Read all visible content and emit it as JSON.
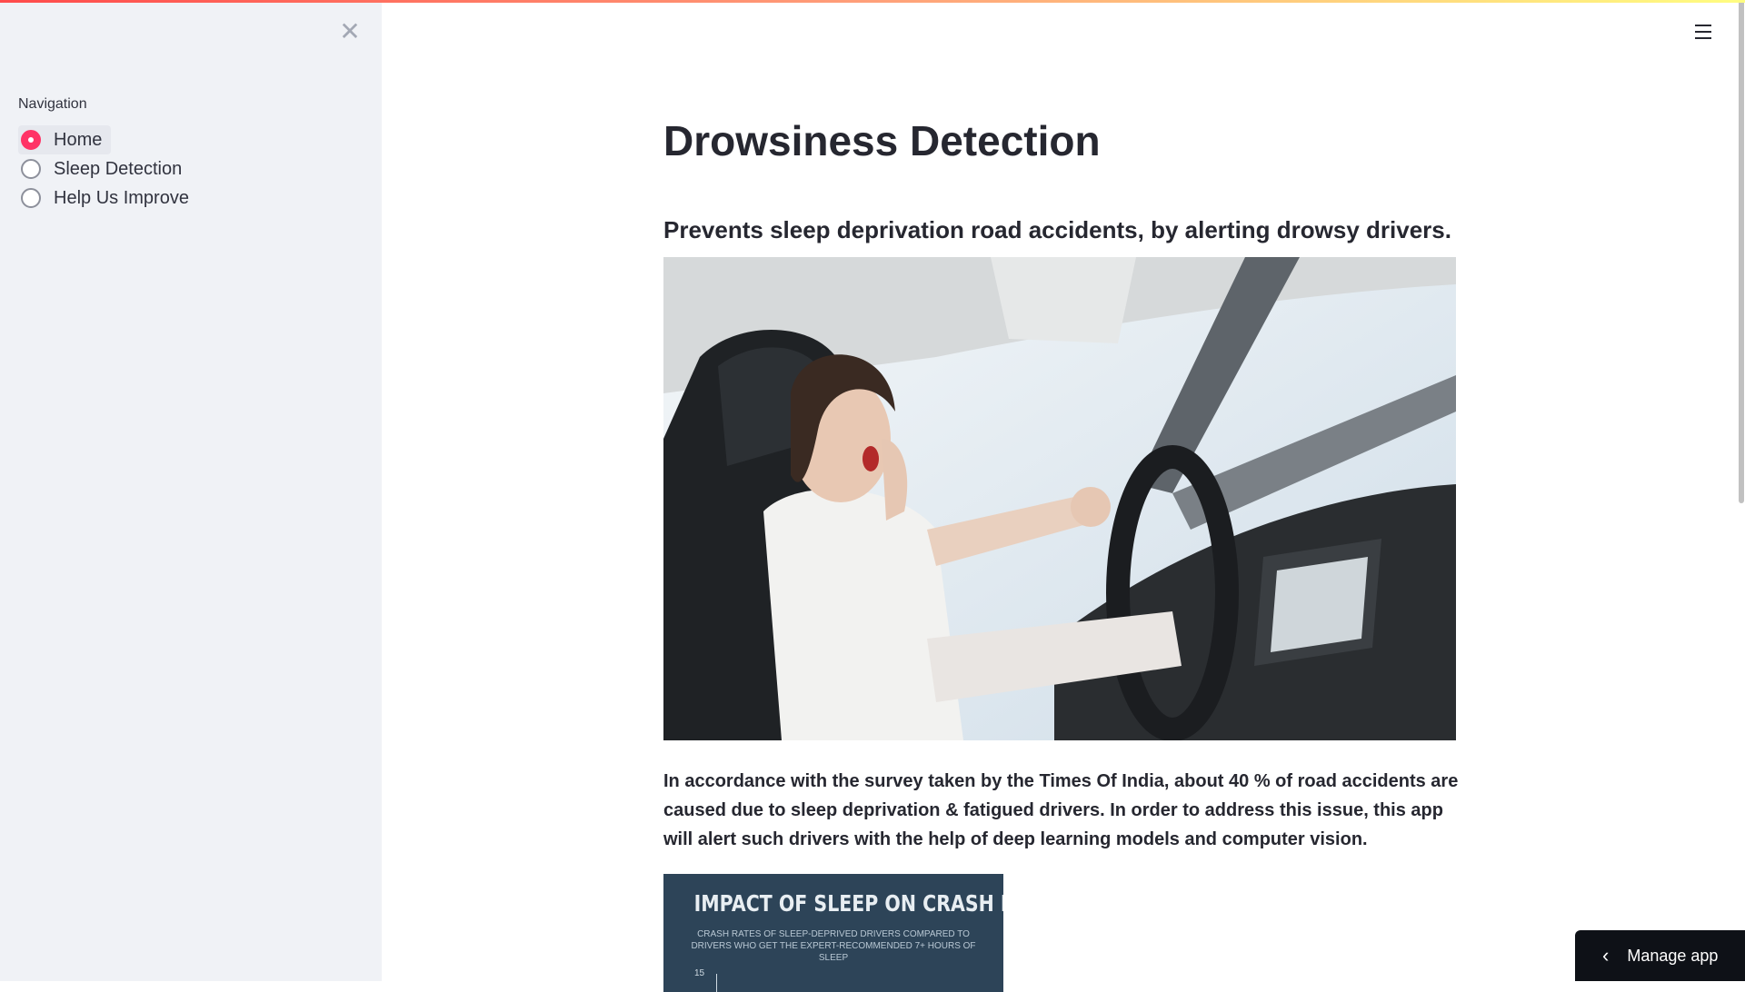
{
  "sidebar": {
    "close_icon": "close-icon",
    "nav_label": "Navigation",
    "items": [
      {
        "label": "Home",
        "selected": true
      },
      {
        "label": "Sleep Detection",
        "selected": false
      },
      {
        "label": "Help Us Improve",
        "selected": false
      }
    ]
  },
  "main": {
    "title": "Drowsiness Detection",
    "subtitle": "Prevents sleep deprivation road accidents, by alerting drowsy drivers.",
    "paragraph": "In accordance with the survey taken by the Times Of India, about 40 % of road accidents are caused due to sleep deprivation & fatigued drivers. In order to address this issue, this app will alert such drivers with the help of deep learning models and computer vision.",
    "infographic": {
      "title": "IMPACT OF SLEEP ON CRASH RISK",
      "subtitle": "CRASH RATES OF SLEEP-DEPRIVED DRIVERS COMPARED TO DRIVERS WHO GET THE EXPERT-RECOMMENDED 7+ HOURS OF SLEEP",
      "tick": "15"
    }
  },
  "header": {
    "menu_icon": "hamburger-menu-icon"
  },
  "footer": {
    "manage_app_label": "Manage app"
  },
  "colors": {
    "accent": "#ff3366",
    "sidebar_bg": "#f0f2f6",
    "manage_bg": "#0e1117",
    "infographic_bg": "#2d4458"
  }
}
